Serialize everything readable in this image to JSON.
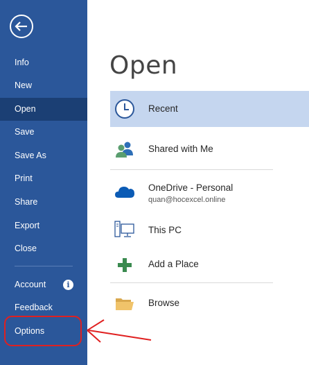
{
  "sidebar": {
    "items": [
      {
        "label": "Info"
      },
      {
        "label": "New"
      },
      {
        "label": "Open"
      },
      {
        "label": "Save"
      },
      {
        "label": "Save As"
      },
      {
        "label": "Print"
      },
      {
        "label": "Share"
      },
      {
        "label": "Export"
      },
      {
        "label": "Close"
      }
    ],
    "lower_items": [
      {
        "label": "Account"
      },
      {
        "label": "Feedback"
      },
      {
        "label": "Options"
      }
    ],
    "back_icon": "back-arrow-icon",
    "account_icon": "info-icon"
  },
  "main": {
    "title": "Open",
    "locations": [
      {
        "label": "Recent",
        "icon": "clock-icon"
      },
      {
        "label": "Shared with Me",
        "icon": "people-icon"
      },
      {
        "label": "OneDrive - Personal",
        "sublabel": "quan@hocexcel.online",
        "icon": "cloud-icon"
      },
      {
        "label": "This PC",
        "icon": "computer-icon"
      },
      {
        "label": "Add a Place",
        "icon": "plus-icon"
      },
      {
        "label": "Browse",
        "icon": "folder-icon"
      }
    ]
  },
  "colors": {
    "sidebar": "#2b579a",
    "sidebar_active": "#1b3f74",
    "selected_row": "#c5d6ef",
    "annotation": "#e02020"
  }
}
